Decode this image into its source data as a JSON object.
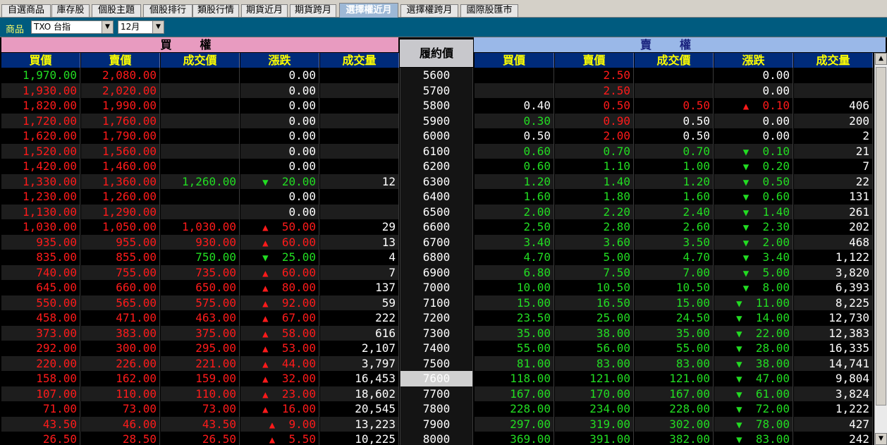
{
  "tabs": [
    {
      "label": "自選商品",
      "active": false
    },
    {
      "label": "庫存股",
      "active": false
    },
    {
      "label": "個股主題",
      "active": false
    },
    {
      "label": "個股排行",
      "active": false
    },
    {
      "label": "類股行情",
      "active": false
    },
    {
      "label": "期貨近月",
      "active": false
    },
    {
      "label": "期貨跨月",
      "active": false
    },
    {
      "label": "選擇權近月",
      "active": true
    },
    {
      "label": "選擇權跨月",
      "active": false
    },
    {
      "label": "國際股匯市",
      "active": false
    }
  ],
  "product": {
    "label": "商品",
    "selected": "TXO 台指",
    "month": "12月"
  },
  "sections": {
    "call": "買權",
    "put": "賣權",
    "strike": "履約價"
  },
  "columns": {
    "call": [
      "買價",
      "賣價",
      "成交價",
      "漲跌",
      "成交量"
    ],
    "put": [
      "買價",
      "賣價",
      "成交價",
      "漲跌",
      "成交量"
    ]
  },
  "colors": {
    "up": "#ff1a1a",
    "down": "#22dd22",
    "flat": "#ffffff",
    "header_text": "#ffff00",
    "header_bg": "#002b7a"
  },
  "rows": [
    {
      "strike": "5600",
      "c": [
        [
          "1,970.00",
          "g"
        ],
        [
          "2,080.00",
          "r"
        ],
        [
          "",
          ""
        ],
        [
          "0.00",
          "w",
          ""
        ],
        [
          "",
          ""
        ]
      ],
      "p": [
        [
          "",
          ""
        ],
        [
          "2.50",
          "r"
        ],
        [
          "",
          ""
        ],
        [
          "0.00",
          "w",
          ""
        ],
        [
          "",
          ""
        ]
      ]
    },
    {
      "strike": "5700",
      "c": [
        [
          "1,930.00",
          "r"
        ],
        [
          "2,020.00",
          "r"
        ],
        [
          "",
          ""
        ],
        [
          "0.00",
          "w",
          ""
        ],
        [
          "",
          ""
        ]
      ],
      "p": [
        [
          "",
          ""
        ],
        [
          "2.50",
          "r"
        ],
        [
          "",
          ""
        ],
        [
          "0.00",
          "w",
          ""
        ],
        [
          "",
          ""
        ]
      ]
    },
    {
      "strike": "5800",
      "c": [
        [
          "1,820.00",
          "r"
        ],
        [
          "1,990.00",
          "r"
        ],
        [
          "",
          ""
        ],
        [
          "0.00",
          "w",
          ""
        ],
        [
          "",
          ""
        ]
      ],
      "p": [
        [
          "0.40",
          "w"
        ],
        [
          "0.50",
          "r"
        ],
        [
          "0.50",
          "r"
        ],
        [
          "0.10",
          "r",
          "up"
        ],
        [
          "406",
          "w"
        ]
      ]
    },
    {
      "strike": "5900",
      "c": [
        [
          "1,720.00",
          "r"
        ],
        [
          "1,760.00",
          "r"
        ],
        [
          "",
          ""
        ],
        [
          "0.00",
          "w",
          ""
        ],
        [
          "",
          ""
        ]
      ],
      "p": [
        [
          "0.30",
          "g"
        ],
        [
          "0.90",
          "r"
        ],
        [
          "0.50",
          "w"
        ],
        [
          "0.00",
          "w",
          ""
        ],
        [
          "200",
          "w"
        ]
      ]
    },
    {
      "strike": "6000",
      "c": [
        [
          "1,620.00",
          "r"
        ],
        [
          "1,790.00",
          "r"
        ],
        [
          "",
          ""
        ],
        [
          "0.00",
          "w",
          ""
        ],
        [
          "",
          ""
        ]
      ],
      "p": [
        [
          "0.50",
          "w"
        ],
        [
          "2.00",
          "r"
        ],
        [
          "0.50",
          "w"
        ],
        [
          "0.00",
          "w",
          ""
        ],
        [
          "2",
          "w"
        ]
      ]
    },
    {
      "strike": "6100",
      "c": [
        [
          "1,520.00",
          "r"
        ],
        [
          "1,560.00",
          "r"
        ],
        [
          "",
          ""
        ],
        [
          "0.00",
          "w",
          ""
        ],
        [
          "",
          ""
        ]
      ],
      "p": [
        [
          "0.60",
          "g"
        ],
        [
          "0.70",
          "g"
        ],
        [
          "0.70",
          "g"
        ],
        [
          "0.10",
          "g",
          "down"
        ],
        [
          "21",
          "w"
        ]
      ]
    },
    {
      "strike": "6200",
      "c": [
        [
          "1,420.00",
          "r"
        ],
        [
          "1,460.00",
          "r"
        ],
        [
          "",
          ""
        ],
        [
          "0.00",
          "w",
          ""
        ],
        [
          "",
          ""
        ]
      ],
      "p": [
        [
          "0.60",
          "g"
        ],
        [
          "1.10",
          "g"
        ],
        [
          "1.00",
          "g"
        ],
        [
          "0.20",
          "g",
          "down"
        ],
        [
          "7",
          "w"
        ]
      ]
    },
    {
      "strike": "6300",
      "c": [
        [
          "1,330.00",
          "r"
        ],
        [
          "1,360.00",
          "r"
        ],
        [
          "1,260.00",
          "g"
        ],
        [
          "20.00",
          "g",
          "down"
        ],
        [
          "12",
          "w"
        ]
      ],
      "p": [
        [
          "1.20",
          "g"
        ],
        [
          "1.40",
          "g"
        ],
        [
          "1.20",
          "g"
        ],
        [
          "0.50",
          "g",
          "down"
        ],
        [
          "22",
          "w"
        ]
      ]
    },
    {
      "strike": "6400",
      "c": [
        [
          "1,230.00",
          "r"
        ],
        [
          "1,260.00",
          "r"
        ],
        [
          "",
          ""
        ],
        [
          "0.00",
          "w",
          ""
        ],
        [
          "",
          ""
        ]
      ],
      "p": [
        [
          "1.60",
          "g"
        ],
        [
          "1.80",
          "g"
        ],
        [
          "1.60",
          "g"
        ],
        [
          "0.60",
          "g",
          "down"
        ],
        [
          "131",
          "w"
        ]
      ]
    },
    {
      "strike": "6500",
      "c": [
        [
          "1,130.00",
          "r"
        ],
        [
          "1,290.00",
          "r"
        ],
        [
          "",
          ""
        ],
        [
          "0.00",
          "w",
          ""
        ],
        [
          "",
          ""
        ]
      ],
      "p": [
        [
          "2.00",
          "g"
        ],
        [
          "2.20",
          "g"
        ],
        [
          "2.40",
          "g"
        ],
        [
          "1.40",
          "g",
          "down"
        ],
        [
          "261",
          "w"
        ]
      ]
    },
    {
      "strike": "6600",
      "c": [
        [
          "1,030.00",
          "r"
        ],
        [
          "1,050.00",
          "r"
        ],
        [
          "1,030.00",
          "r"
        ],
        [
          "50.00",
          "r",
          "up"
        ],
        [
          "29",
          "w"
        ]
      ],
      "p": [
        [
          "2.50",
          "g"
        ],
        [
          "2.80",
          "g"
        ],
        [
          "2.60",
          "g"
        ],
        [
          "2.30",
          "g",
          "down"
        ],
        [
          "202",
          "w"
        ]
      ]
    },
    {
      "strike": "6700",
      "c": [
        [
          "935.00",
          "r"
        ],
        [
          "955.00",
          "r"
        ],
        [
          "930.00",
          "r"
        ],
        [
          "60.00",
          "r",
          "up"
        ],
        [
          "13",
          "w"
        ]
      ],
      "p": [
        [
          "3.40",
          "g"
        ],
        [
          "3.60",
          "g"
        ],
        [
          "3.50",
          "g"
        ],
        [
          "2.00",
          "g",
          "down"
        ],
        [
          "468",
          "w"
        ]
      ]
    },
    {
      "strike": "6800",
      "c": [
        [
          "835.00",
          "r"
        ],
        [
          "855.00",
          "r"
        ],
        [
          "750.00",
          "g"
        ],
        [
          "25.00",
          "g",
          "down"
        ],
        [
          "4",
          "w"
        ]
      ],
      "p": [
        [
          "4.70",
          "g"
        ],
        [
          "5.00",
          "g"
        ],
        [
          "4.70",
          "g"
        ],
        [
          "3.40",
          "g",
          "down"
        ],
        [
          "1,122",
          "w"
        ]
      ]
    },
    {
      "strike": "6900",
      "c": [
        [
          "740.00",
          "r"
        ],
        [
          "755.00",
          "r"
        ],
        [
          "735.00",
          "r"
        ],
        [
          "60.00",
          "r",
          "up"
        ],
        [
          "7",
          "w"
        ]
      ],
      "p": [
        [
          "6.80",
          "g"
        ],
        [
          "7.50",
          "g"
        ],
        [
          "7.00",
          "g"
        ],
        [
          "5.00",
          "g",
          "down"
        ],
        [
          "3,820",
          "w"
        ]
      ]
    },
    {
      "strike": "7000",
      "c": [
        [
          "645.00",
          "r"
        ],
        [
          "660.00",
          "r"
        ],
        [
          "650.00",
          "r"
        ],
        [
          "80.00",
          "r",
          "up"
        ],
        [
          "137",
          "w"
        ]
      ],
      "p": [
        [
          "10.00",
          "g"
        ],
        [
          "10.50",
          "g"
        ],
        [
          "10.50",
          "g"
        ],
        [
          "8.00",
          "g",
          "down"
        ],
        [
          "6,393",
          "w"
        ]
      ]
    },
    {
      "strike": "7100",
      "c": [
        [
          "550.00",
          "r"
        ],
        [
          "565.00",
          "r"
        ],
        [
          "575.00",
          "r"
        ],
        [
          "92.00",
          "r",
          "up"
        ],
        [
          "59",
          "w"
        ]
      ],
      "p": [
        [
          "15.00",
          "g"
        ],
        [
          "16.50",
          "g"
        ],
        [
          "15.00",
          "g"
        ],
        [
          "11.00",
          "g",
          "down"
        ],
        [
          "8,225",
          "w"
        ]
      ]
    },
    {
      "strike": "7200",
      "c": [
        [
          "458.00",
          "r"
        ],
        [
          "471.00",
          "r"
        ],
        [
          "463.00",
          "r"
        ],
        [
          "67.00",
          "r",
          "up"
        ],
        [
          "222",
          "w"
        ]
      ],
      "p": [
        [
          "23.50",
          "g"
        ],
        [
          "25.00",
          "g"
        ],
        [
          "24.50",
          "g"
        ],
        [
          "14.00",
          "g",
          "down"
        ],
        [
          "12,730",
          "w"
        ]
      ]
    },
    {
      "strike": "7300",
      "c": [
        [
          "373.00",
          "r"
        ],
        [
          "383.00",
          "r"
        ],
        [
          "375.00",
          "r"
        ],
        [
          "58.00",
          "r",
          "up"
        ],
        [
          "616",
          "w"
        ]
      ],
      "p": [
        [
          "35.00",
          "g"
        ],
        [
          "38.00",
          "g"
        ],
        [
          "35.00",
          "g"
        ],
        [
          "22.00",
          "g",
          "down"
        ],
        [
          "12,383",
          "w"
        ]
      ]
    },
    {
      "strike": "7400",
      "c": [
        [
          "292.00",
          "r"
        ],
        [
          "300.00",
          "r"
        ],
        [
          "295.00",
          "r"
        ],
        [
          "53.00",
          "r",
          "up"
        ],
        [
          "2,107",
          "w"
        ]
      ],
      "p": [
        [
          "55.00",
          "g"
        ],
        [
          "56.00",
          "g"
        ],
        [
          "55.00",
          "g"
        ],
        [
          "28.00",
          "g",
          "down"
        ],
        [
          "16,335",
          "w"
        ]
      ]
    },
    {
      "strike": "7500",
      "c": [
        [
          "220.00",
          "r"
        ],
        [
          "226.00",
          "r"
        ],
        [
          "221.00",
          "r"
        ],
        [
          "44.00",
          "r",
          "up"
        ],
        [
          "3,797",
          "w"
        ]
      ],
      "p": [
        [
          "81.00",
          "g"
        ],
        [
          "83.00",
          "g"
        ],
        [
          "83.00",
          "g"
        ],
        [
          "38.00",
          "g",
          "down"
        ],
        [
          "14,741",
          "w"
        ]
      ]
    },
    {
      "strike": "7600",
      "atm": true,
      "c": [
        [
          "158.00",
          "r"
        ],
        [
          "162.00",
          "r"
        ],
        [
          "159.00",
          "r"
        ],
        [
          "32.00",
          "r",
          "up"
        ],
        [
          "16,453",
          "w"
        ]
      ],
      "p": [
        [
          "118.00",
          "g"
        ],
        [
          "121.00",
          "g"
        ],
        [
          "121.00",
          "g"
        ],
        [
          "47.00",
          "g",
          "down"
        ],
        [
          "9,804",
          "w"
        ]
      ]
    },
    {
      "strike": "7700",
      "c": [
        [
          "107.00",
          "r"
        ],
        [
          "110.00",
          "r"
        ],
        [
          "110.00",
          "r"
        ],
        [
          "23.00",
          "r",
          "up"
        ],
        [
          "18,602",
          "w"
        ]
      ],
      "p": [
        [
          "167.00",
          "g"
        ],
        [
          "170.00",
          "g"
        ],
        [
          "167.00",
          "g"
        ],
        [
          "61.00",
          "g",
          "down"
        ],
        [
          "3,824",
          "w"
        ]
      ]
    },
    {
      "strike": "7800",
      "c": [
        [
          "71.00",
          "r"
        ],
        [
          "73.00",
          "r"
        ],
        [
          "73.00",
          "r"
        ],
        [
          "16.00",
          "r",
          "up"
        ],
        [
          "20,545",
          "w"
        ]
      ],
      "p": [
        [
          "228.00",
          "g"
        ],
        [
          "234.00",
          "g"
        ],
        [
          "228.00",
          "g"
        ],
        [
          "72.00",
          "g",
          "down"
        ],
        [
          "1,222",
          "w"
        ]
      ]
    },
    {
      "strike": "7900",
      "c": [
        [
          "43.50",
          "r"
        ],
        [
          "46.00",
          "r"
        ],
        [
          "43.50",
          "r"
        ],
        [
          "9.00",
          "r",
          "up"
        ],
        [
          "13,223",
          "w"
        ]
      ],
      "p": [
        [
          "297.00",
          "g"
        ],
        [
          "319.00",
          "g"
        ],
        [
          "302.00",
          "g"
        ],
        [
          "78.00",
          "g",
          "down"
        ],
        [
          "427",
          "w"
        ]
      ]
    },
    {
      "strike": "8000",
      "c": [
        [
          "26.50",
          "r"
        ],
        [
          "28.50",
          "r"
        ],
        [
          "26.50",
          "r"
        ],
        [
          "5.50",
          "r",
          "up"
        ],
        [
          "10,225",
          "w"
        ]
      ],
      "p": [
        [
          "369.00",
          "g"
        ],
        [
          "391.00",
          "g"
        ],
        [
          "382.00",
          "g"
        ],
        [
          "83.00",
          "g",
          "down"
        ],
        [
          "242",
          "w"
        ]
      ]
    }
  ]
}
